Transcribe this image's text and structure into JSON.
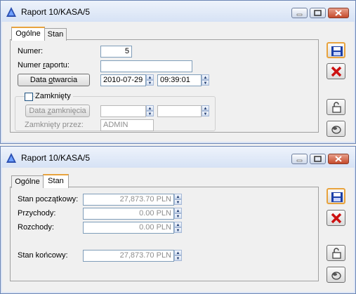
{
  "window1": {
    "title": "Raport 10/KASA/5",
    "tabs": [
      {
        "label": "Ogólne",
        "active": true
      },
      {
        "label": "Stan",
        "active": false
      }
    ],
    "general": {
      "numer_label": "Numer:",
      "numer_value": "5",
      "numer_raportu_label_pre": "Numer ",
      "numer_raportu_label_u": "r",
      "numer_raportu_label_post": "aportu:",
      "numer_raportu_value": "",
      "data_otwarcia_pre": "Data ",
      "data_otwarcia_u": "o",
      "data_otwarcia_post": "twarcia",
      "data_otwarcia_date": "2010-07-29",
      "data_otwarcia_time": "09:39:01",
      "zamkniety_label": "Zamknięty",
      "zamkniety_checked": false,
      "data_zamkniecia_pre": "Data ",
      "data_zamkniecia_u": "z",
      "data_zamkniecia_post": "amknięcia",
      "data_zamkniecia_date": "",
      "data_zamkniecia_time": "",
      "zamkniety_przez_label": "Zamknięty przez:",
      "zamkniety_przez_value": "ADMIN"
    }
  },
  "window2": {
    "title": "Raport 10/KASA/5",
    "tabs": [
      {
        "label": "Ogólne",
        "active": false
      },
      {
        "label": "Stan",
        "active": true
      }
    ],
    "stan": {
      "stan_poczatkowy_label": "Stan początkowy:",
      "stan_poczatkowy_value": "27,873.70 PLN",
      "przychody_label": "Przychody:",
      "przychody_value": "0.00 PLN",
      "rozchody_label": "Rozchody:",
      "rozchody_value": "0.00 PLN",
      "stan_koncowy_label": "Stan końcowy:",
      "stan_koncowy_value": "27,873.70 PLN"
    }
  },
  "side_buttons": [
    "save-icon",
    "delete-icon",
    "lock-icon",
    "eraser-icon"
  ],
  "colors": {
    "accent": "#e8a33d",
    "title_bar": "#dce5f5",
    "delete_red": "#cc1010",
    "save_blue": "#1a3fa8"
  }
}
